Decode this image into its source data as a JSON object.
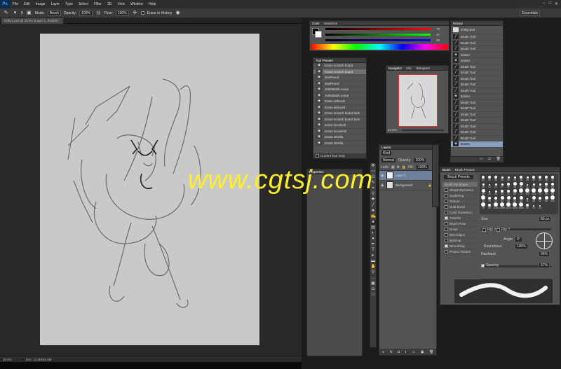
{
  "app": {
    "logo": "Ps",
    "menus": [
      "File",
      "Edit",
      "Image",
      "Layer",
      "Type",
      "Select",
      "Filter",
      "3D",
      "View",
      "Window",
      "Help"
    ],
    "window_controls": [
      "–",
      "□",
      "✕"
    ]
  },
  "options": {
    "size": "8",
    "mode_label": "Mode:",
    "mode_value": "Brush",
    "opacity_label": "Opacity:",
    "opacity_value": "100%",
    "flow_label": "Flow:",
    "flow_value": "100%",
    "erase_history": "Erase to History",
    "workspace": "Essentials"
  },
  "document": {
    "tab_title": "shifty1.psd @ 33.8% (Layer 1, RGB/8) *",
    "zoom": "33.8%",
    "doc_size": "Doc: 14.0M/33.9M"
  },
  "color_panel": {
    "tabs": [
      "Color",
      "Swatches"
    ],
    "r": "70",
    "g": "47",
    "b": "29"
  },
  "history": {
    "tab": "History",
    "snapshot": "shiftyl.psd",
    "items": [
      "Brush Tool",
      "Brush Tool",
      "Brush Tool",
      "Eraser",
      "Eraser",
      "Brush Tool",
      "Brush Tool",
      "Brush Tool",
      "Brush Tool",
      "Brush Tool",
      "Eraser",
      "Brush Tool",
      "Brush Tool",
      "Brush Tool",
      "Brush Tool",
      "Brush Tool",
      "Brush Tool",
      "Brush Tool",
      "Eraser"
    ]
  },
  "tool_presets": {
    "tab": "Tool Presets",
    "items": [
      "Erase scratch board",
      "Erase scratch board",
      "sketPencil",
      "sketPencil",
      "JeltettBalls erase",
      "JeltettBalls erase",
      "Erase airbrush",
      "Erase airbrush",
      "Erase scratch board fade",
      "Erase scratch board fade",
      "erase scruiiirub",
      "Erase scruiiirub",
      "Erase Distilla",
      "Erase Distilla"
    ],
    "current_only": "Current Tool Only"
  },
  "navigator": {
    "tabs": [
      "Navigator",
      "Info",
      "Histogram"
    ],
    "zoom": "33.8%"
  },
  "layers": {
    "tab": "Layers",
    "kind": "Kind",
    "blend": "Normal",
    "opacity_label": "Opacity:",
    "opacity": "100%",
    "lock_label": "Lock:",
    "fill_label": "Fill:",
    "fill": "100%",
    "items": [
      {
        "name": "Layer 1",
        "selected": true
      },
      {
        "name": "Background",
        "locked": true
      }
    ]
  },
  "properties": {
    "tab": "Properties"
  },
  "brush": {
    "tabs": [
      "Brush",
      "Brush Presets"
    ],
    "presets_btn": "Brush Presets",
    "options": [
      "Brush Tip Shape",
      "Shape Dynamics",
      "Scattering",
      "Texture",
      "Dual Brush",
      "Color Dynamics",
      "Transfer",
      "Brush Pose",
      "Noise",
      "Wet Edges",
      "Build-up",
      "Smoothing",
      "Protect Texture"
    ],
    "checked": [
      false,
      false,
      false,
      false,
      false,
      false,
      true,
      false,
      false,
      false,
      false,
      true,
      false
    ],
    "size_label": "Size",
    "size": "80 px",
    "flipx": "Flip X",
    "flipy": "Flip Y",
    "angle_label": "Angle:",
    "angle": "0°",
    "roundness_label": "Roundness:",
    "roundness": "100%",
    "hardness_label": "Hardness",
    "hardness": "96%",
    "spacing_label": "Spacing",
    "spacing": "67%",
    "tip_sizes": [
      "30",
      "30",
      "30",
      "25",
      "25",
      "25",
      "36",
      "25",
      "36",
      "36",
      "36",
      "32",
      "25",
      "14",
      "24",
      "27",
      "39",
      "46",
      "59",
      "11",
      "17",
      "23",
      "36",
      "44",
      "60",
      "14",
      "26",
      "33",
      "42",
      "55",
      "70",
      "112",
      "134",
      "74",
      "95",
      "95",
      "90",
      "36",
      "33",
      "63",
      "66",
      "39",
      "63",
      "11",
      "48",
      "32",
      "55",
      "100",
      "75",
      "45",
      "1106",
      "1499",
      "1473",
      "1290",
      "1640",
      "34",
      "14",
      "14"
    ]
  },
  "watermark": "www.cgtsj.com"
}
